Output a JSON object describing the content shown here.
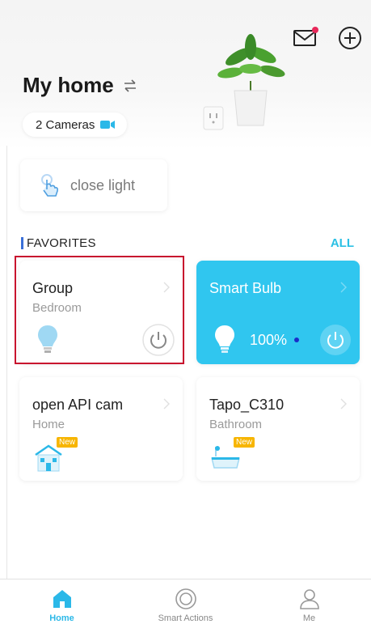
{
  "header": {
    "home_title": "My home",
    "cameras_label": "2 Cameras"
  },
  "scene": {
    "label": "close light"
  },
  "favorites": {
    "title": "FAVORITES",
    "all_label": "ALL"
  },
  "devices": [
    {
      "name": "Group",
      "room": "Bedroom"
    },
    {
      "name": "Smart Bulb",
      "brightness": "100%"
    },
    {
      "name": "open API cam",
      "room": "Home",
      "badge": "New"
    },
    {
      "name": "Tapo_C310",
      "room": "Bathroom",
      "badge": "New"
    }
  ],
  "tabbar": {
    "items": [
      {
        "label": "Home"
      },
      {
        "label": "Smart Actions"
      },
      {
        "label": "Me"
      }
    ]
  },
  "colors": {
    "accent": "#2bc0e4",
    "active_card": "#30c6ef",
    "badge": "#f7b500",
    "highlight": "#c8102e"
  }
}
